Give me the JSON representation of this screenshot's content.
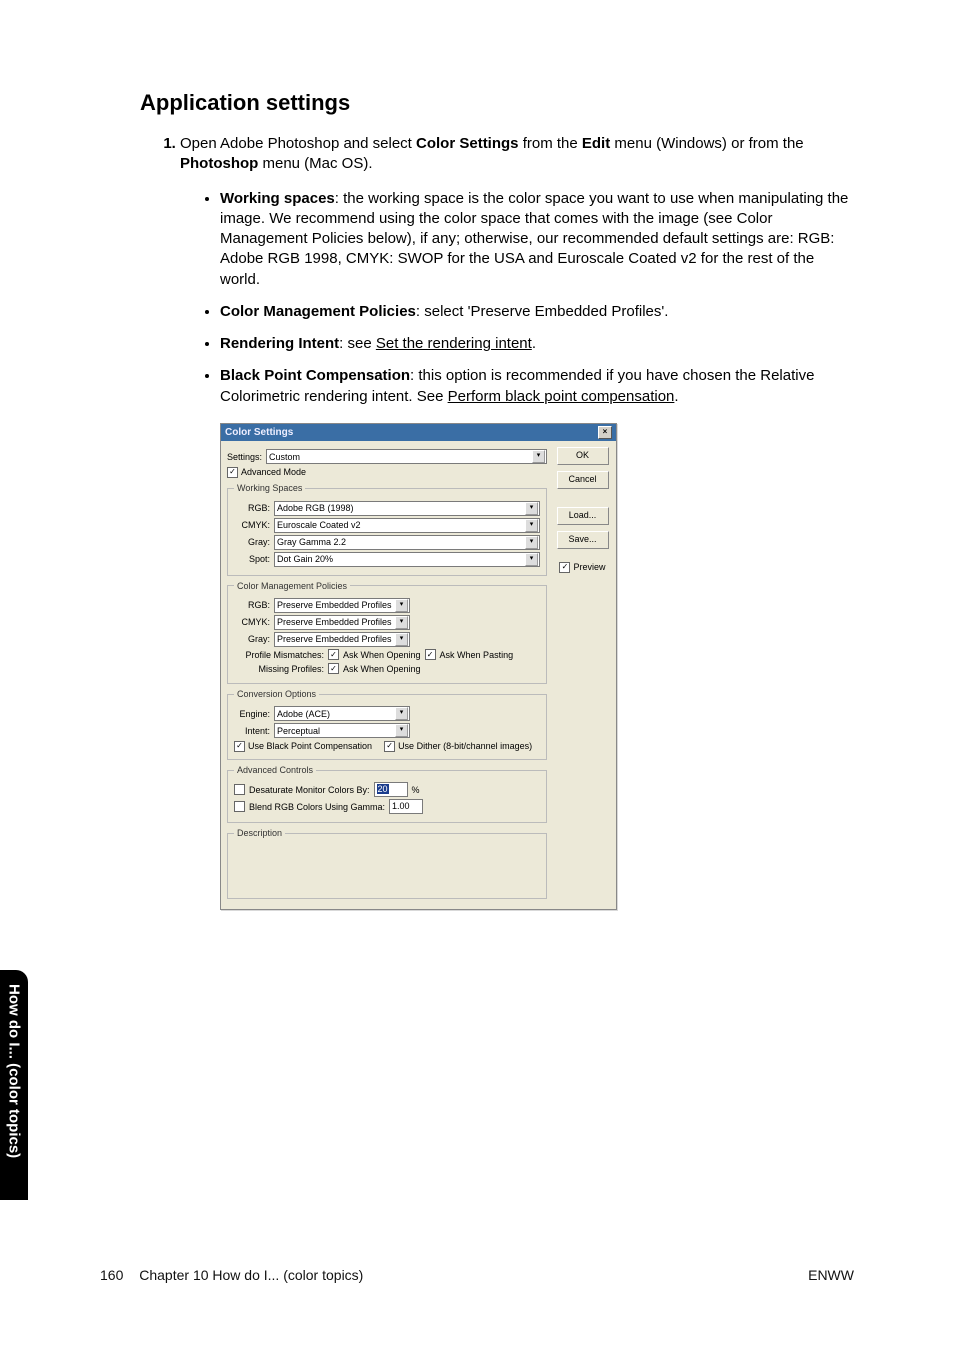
{
  "heading": "Application settings",
  "step1": {
    "pre": "Open Adobe Photoshop and select ",
    "bold1": "Color Settings",
    "mid1": " from the ",
    "bold2": "Edit",
    "mid2": " menu (Windows) or from the ",
    "bold3": "Photoshop",
    "post": " menu (Mac OS)."
  },
  "bullets": {
    "ws": {
      "label": "Working spaces",
      "text": ": the working space is the color space you want to use when manipulating the image. We recommend using the color space that comes with the image (see Color Management Policies below), if any; otherwise, our recommended default settings are: RGB: Adobe RGB 1998, CMYK: SWOP for the USA and Euroscale Coated v2 for the rest of the world."
    },
    "cmp": {
      "label": "Color Management Policies",
      "text": ": select 'Preserve Embedded Profiles'."
    },
    "ri": {
      "label": "Rendering Intent",
      "mid": ": see ",
      "link": "Set the rendering intent",
      "post": "."
    },
    "bpc": {
      "label": "Black Point Compensation",
      "mid": ": this option is recommended if you have chosen the Relative Colorimetric rendering intent. See ",
      "link": "Perform black point compensation",
      "post": "."
    }
  },
  "dialog": {
    "title": "Color Settings",
    "close": "×",
    "settings_label": "Settings:",
    "settings_value": "Custom",
    "advanced_mode": "Advanced Mode",
    "groups": {
      "working_spaces": {
        "legend": "Working Spaces",
        "rgb_label": "RGB:",
        "rgb_value": "Adobe RGB (1998)",
        "cmyk_label": "CMYK:",
        "cmyk_value": "Euroscale Coated v2",
        "gray_label": "Gray:",
        "gray_value": "Gray Gamma 2.2",
        "spot_label": "Spot:",
        "spot_value": "Dot Gain 20%"
      },
      "policies": {
        "legend": "Color Management Policies",
        "rgb_label": "RGB:",
        "rgb_value": "Preserve Embedded Profiles",
        "cmyk_label": "CMYK:",
        "cmyk_value": "Preserve Embedded Profiles",
        "gray_label": "Gray:",
        "gray_value": "Preserve Embedded Profiles",
        "mismatch_label": "Profile Mismatches:",
        "mismatch_open": "Ask When Opening",
        "mismatch_paste": "Ask When Pasting",
        "missing_label": "Missing Profiles:",
        "missing_open": "Ask When Opening"
      },
      "conversion": {
        "legend": "Conversion Options",
        "engine_label": "Engine:",
        "engine_value": "Adobe (ACE)",
        "intent_label": "Intent:",
        "intent_value": "Perceptual",
        "bpc": "Use Black Point Compensation",
        "dither": "Use Dither (8-bit/channel images)"
      },
      "advanced": {
        "legend": "Advanced Controls",
        "desat_label": "Desaturate Monitor Colors By:",
        "desat_value": "20",
        "desat_unit": "%",
        "blend_label": "Blend RGB Colors Using Gamma:",
        "blend_value": "1.00"
      },
      "description": {
        "legend": "Description"
      }
    },
    "buttons": {
      "ok": "OK",
      "cancel": "Cancel",
      "load": "Load...",
      "save": "Save...",
      "preview": "Preview"
    }
  },
  "side_tab": "How do I... (color topics)",
  "footer": {
    "page_no": "160",
    "chapter": "Chapter 10    How do I... (color topics)",
    "right": "ENWW"
  }
}
